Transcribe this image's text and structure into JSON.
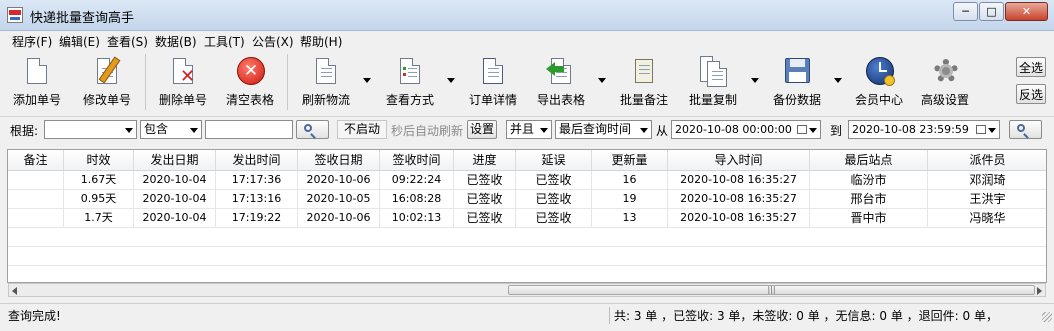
{
  "window": {
    "title": "快递批量查询高手"
  },
  "menu": [
    "程序(F)",
    "编辑(E)",
    "查看(S)",
    "数据(B)",
    "工具(T)",
    "公告(X)",
    "帮助(H)"
  ],
  "toolbar": {
    "add": "添加单号",
    "edit": "修改单号",
    "delete": "删除单号",
    "clear": "清空表格",
    "refresh": "刷新物流",
    "view_mode": "查看方式",
    "order_detail": "订单详情",
    "export": "导出表格",
    "batch_note": "批量备注",
    "batch_copy": "批量复制",
    "backup": "备份数据",
    "member": "会员中心",
    "advanced": "高级设置"
  },
  "side_buttons": {
    "select_all": "全选",
    "invert": "反选"
  },
  "filter": {
    "by_label": "根据:",
    "by_value": "",
    "match": "包含",
    "keyword": "",
    "auto_toggle": "不启动",
    "auto_text": "秒后自动刷新",
    "settings": "设置",
    "logic": "并且",
    "time_field": "最后查询时间",
    "from_label": "从",
    "from": "2020-10-08 00:00:00",
    "to_label": "到",
    "to": "2020-10-08 23:59:59"
  },
  "table": {
    "columns": [
      "备注",
      "时效",
      "发出日期",
      "发出时间",
      "签收日期",
      "签收时间",
      "进度",
      "延误",
      "更新量",
      "导入时间",
      "最后站点",
      "派件员"
    ],
    "rows": [
      [
        "",
        "1.67天",
        "2020-10-04",
        "17:17:36",
        "2020-10-06",
        "09:22:24",
        "已签收",
        "已签收",
        "16",
        "2020-10-08 16:35:27",
        "临汾市",
        "邓润琦"
      ],
      [
        "",
        "0.95天",
        "2020-10-04",
        "17:13:16",
        "2020-10-05",
        "16:08:28",
        "已签收",
        "已签收",
        "19",
        "2020-10-08 16:35:27",
        "邢台市",
        "王洪宇"
      ],
      [
        "",
        "1.7天",
        "2020-10-04",
        "17:19:22",
        "2020-10-06",
        "10:02:13",
        "已签收",
        "已签收",
        "13",
        "2020-10-08 16:35:27",
        "晋中市",
        "冯晓华"
      ]
    ]
  },
  "status": {
    "left": "查询完成!",
    "right": "共: 3 单 ，已签收:  3 单，未签收:  0 单 ，无信息: 0 单 ，退回件: 0 单，"
  }
}
